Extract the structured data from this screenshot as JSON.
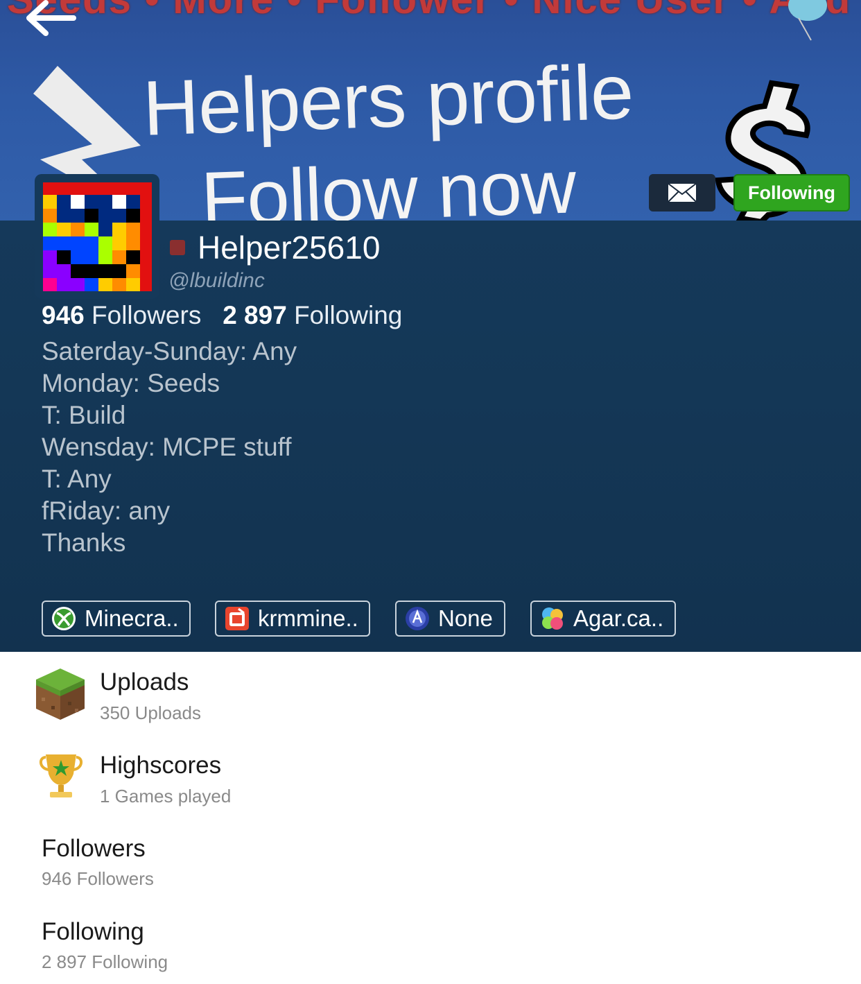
{
  "banner": {
    "top_text": "Seeds • More • Follower • Nice User • And more",
    "line1": "Helpers profile",
    "line2": "Follow now"
  },
  "actions": {
    "message_icon": "envelope-icon",
    "follow_label": "Following",
    "follow_color": "#2fa51f"
  },
  "profile": {
    "status_color": "#8a2f2f",
    "username": "Helper25610",
    "handle": "@lbuildinc",
    "followers_count": "946",
    "followers_label": "Followers",
    "following_count": "2 897",
    "following_label": "Following",
    "bio": [
      "Saterday-Sunday: Any",
      "Monday: Seeds",
      "T: Build",
      "Wensday: MCPE stuff",
      "T: Any",
      "fRiday: any",
      "Thanks"
    ]
  },
  "games": [
    {
      "icon": "xbox-icon",
      "label": "Minecra.."
    },
    {
      "icon": "app-icon",
      "label": "krmmine.."
    },
    {
      "icon": "playstation-icon",
      "label": "None"
    },
    {
      "icon": "game-center-icon",
      "label": "Agar.ca.."
    }
  ],
  "sections": {
    "uploads": {
      "icon": "grass-block-icon",
      "title": "Uploads",
      "subtitle": "350 Uploads"
    },
    "highscores": {
      "icon": "trophy-icon",
      "title": "Highscores",
      "subtitle": "1 Games played"
    },
    "followers": {
      "title": "Followers",
      "subtitle": "946 Followers"
    },
    "following": {
      "title": "Following",
      "subtitle": "2 897 Following"
    }
  }
}
